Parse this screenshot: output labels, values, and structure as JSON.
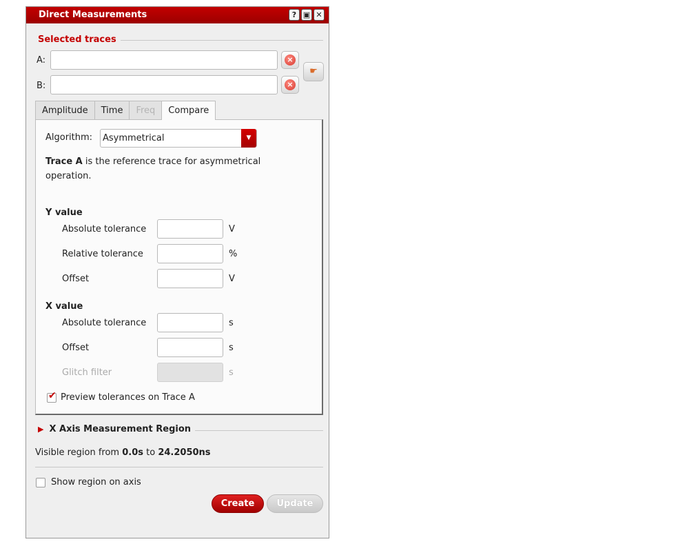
{
  "window": {
    "title": "Direct Measurements",
    "buttons": [
      "?",
      "▣",
      "✕"
    ]
  },
  "selected_traces": {
    "heading": "Selected traces",
    "a_label": "A:",
    "a_value": "",
    "b_label": "B:",
    "b_value": ""
  },
  "tabs": [
    {
      "label": "Amplitude",
      "state": "normal"
    },
    {
      "label": "Time",
      "state": "normal"
    },
    {
      "label": "Freq",
      "state": "disabled"
    },
    {
      "label": "Compare",
      "state": "active"
    }
  ],
  "compare": {
    "algorithm_label": "Algorithm:",
    "algorithm_value": "Asymmetrical",
    "desc_bold": "Trace A",
    "desc_rest": " is the reference trace for asymmetrical operation.",
    "y_heading": "Y value",
    "y_rows": [
      {
        "label": "Absolute tolerance",
        "value": "",
        "unit": "V"
      },
      {
        "label": "Relative tolerance",
        "value": "",
        "unit": "%"
      },
      {
        "label": "Offset",
        "value": "",
        "unit": "V"
      }
    ],
    "x_heading": "X value",
    "x_rows": [
      {
        "label": "Absolute tolerance",
        "value": "",
        "unit": "s"
      },
      {
        "label": "Offset",
        "value": "",
        "unit": "s"
      },
      {
        "label": "Glitch filter",
        "value": "",
        "unit": "s"
      }
    ],
    "preview_label": "Preview tolerances on Trace A",
    "preview_checked": true
  },
  "x_axis_region": {
    "heading": "X Axis Measurement Region",
    "region_prefix": "Visible region from ",
    "region_from": "0.0s",
    "region_mid": " to ",
    "region_to": "24.2050ns",
    "show_region_label": "Show region on axis",
    "show_region_checked": false
  },
  "actions": {
    "create_label": "Create",
    "update_label": "Update"
  },
  "colors": {
    "accent": "#c40000",
    "title_bar": "#b00000",
    "panel_bg": "#efefef"
  }
}
